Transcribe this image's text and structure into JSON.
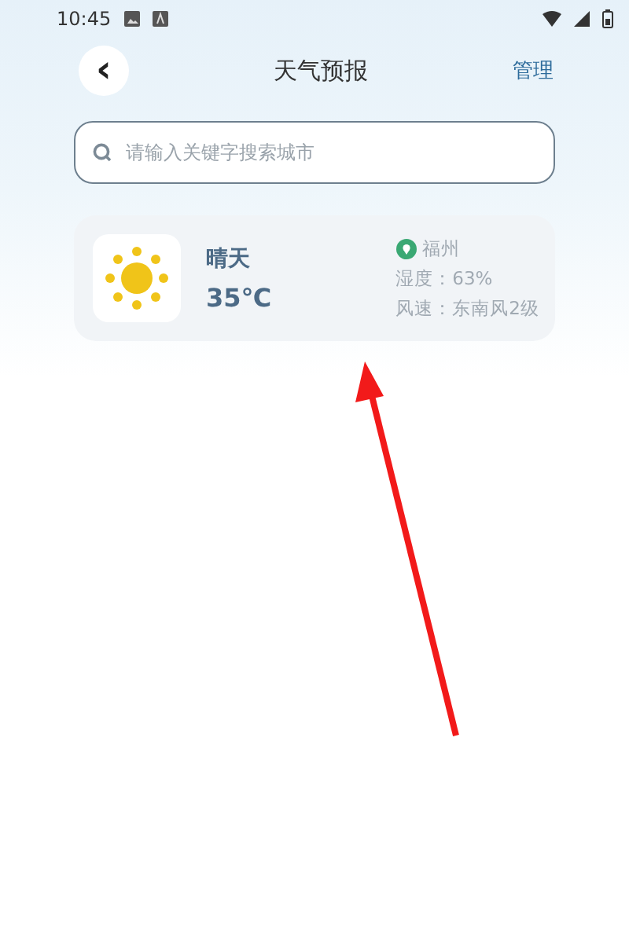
{
  "status_bar": {
    "time": "10:45"
  },
  "header": {
    "back": "‹",
    "title": "天气预报",
    "action": "管理"
  },
  "search": {
    "placeholder": "请输入关键字搜索城市"
  },
  "weather_card": {
    "condition": "晴天",
    "temperature": "35℃",
    "city": "福州",
    "humidity": "湿度：63%",
    "wind": "风速：东南风2级"
  }
}
